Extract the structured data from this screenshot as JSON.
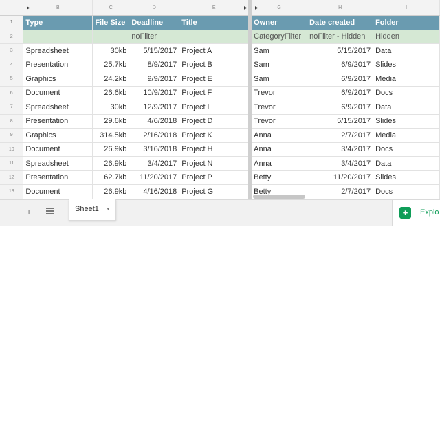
{
  "col_headers": [
    "",
    "B",
    "C",
    "D",
    "E",
    "G",
    "H",
    "I"
  ],
  "header_row": {
    "row": "1",
    "cells": [
      "Type",
      "File Size",
      "Deadline",
      "Title",
      "Owner",
      "Date created",
      "Folder"
    ]
  },
  "filter_row": {
    "row": "2",
    "cells": [
      "",
      "",
      "noFilter",
      "",
      "CategoryFilter",
      "noFilter - Hidden",
      "Hidden"
    ]
  },
  "rows": [
    {
      "row": "3",
      "cells": [
        "Spreadsheet",
        "30kb",
        "5/15/2017",
        "Project A",
        "Sam",
        "5/15/2017",
        "Data"
      ]
    },
    {
      "row": "4",
      "cells": [
        "Presentation",
        "25.7kb",
        "8/9/2017",
        "Project B",
        "Sam",
        "6/9/2017",
        "Slides"
      ]
    },
    {
      "row": "5",
      "cells": [
        "Graphics",
        "24.2kb",
        "9/9/2017",
        "Project E",
        "Sam",
        "6/9/2017",
        "Media"
      ]
    },
    {
      "row": "6",
      "cells": [
        "Document",
        "26.6kb",
        "10/9/2017",
        "Project F",
        "Trevor",
        "6/9/2017",
        "Docs"
      ]
    },
    {
      "row": "7",
      "cells": [
        "Spreadsheet",
        "30kb",
        "12/9/2017",
        "Project L",
        "Trevor",
        "6/9/2017",
        "Data"
      ]
    },
    {
      "row": "8",
      "cells": [
        "Presentation",
        "29.6kb",
        "4/6/2018",
        "Project D",
        "Trevor",
        "5/15/2017",
        "Slides"
      ]
    },
    {
      "row": "9",
      "cells": [
        "Graphics",
        "314.5kb",
        "2/16/2018",
        "Project K",
        "Anna",
        "2/7/2017",
        "Media"
      ]
    },
    {
      "row": "10",
      "cells": [
        "Document",
        "26.9kb",
        "3/16/2018",
        "Project H",
        "Anna",
        "3/4/2017",
        "Docs"
      ]
    },
    {
      "row": "11",
      "cells": [
        "Spreadsheet",
        "26.9kb",
        "3/4/2017",
        "Project N",
        "Anna",
        "3/4/2017",
        "Data"
      ]
    },
    {
      "row": "12",
      "cells": [
        "Presentation",
        "62.7kb",
        "11/20/2017",
        "Project P",
        "Betty",
        "11/20/2017",
        "Slides"
      ]
    },
    {
      "row": "13",
      "cells": [
        "Document",
        "26.9kb",
        "4/16/2018",
        "Project G",
        "Betty",
        "2/7/2017",
        "Docs"
      ]
    }
  ],
  "colors": {
    "header_bg": "#6a9bb0",
    "filter_bg": "#d5e8d4",
    "explore_green": "#0f9d58"
  },
  "tabbar": {
    "add_icon": "plus-icon",
    "list_icon": "all-sheets-list-icon",
    "sheet_tab": "Sheet1",
    "explore_icon": "explore-icon",
    "explore_label": "Explo"
  }
}
